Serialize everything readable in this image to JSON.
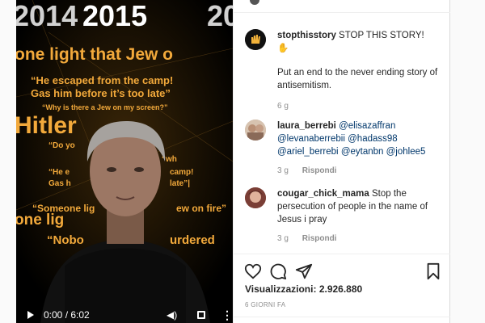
{
  "video": {
    "overlay_lines": [
      "2014",
      "2015",
      "20",
      "one light that Jew o",
      "“He escaped from the camp!",
      "Gas him before it’s too late”",
      "“Why is there a Jew on my screen?”",
      "Hitler",
      "“Do yo",
      "“wh",
      "“He e",
      "camp!",
      "Gas h",
      "late”|",
      "“Someone lig",
      "ew on fire”",
      "one lig",
      "“Nobo",
      "urdered"
    ],
    "time": "0:00 / 6:02",
    "progress": 0
  },
  "caption": {
    "username": "stopthisstory",
    "text_line1": "STOP THIS STORY!",
    "emoji": "✋",
    "text_line2": "Put an end to the never ending story of antisemitism.",
    "age": "6 g"
  },
  "comments": [
    {
      "username": "laura_berrebi",
      "mentions": [
        "@elisazaffran",
        "@levanaberrebii",
        "@hadass98",
        "@ariel_berrebi",
        "@eytanbn",
        "@johlee5"
      ],
      "age": "3 g",
      "reply": "Rispondi"
    },
    {
      "username": "cougar_chick_mama",
      "text": "Stop the persecution of people in the name of Jesus i pray",
      "age": "3 g",
      "reply": "Rispondi"
    }
  ],
  "stats": {
    "views_label": "Visualizzazioni:",
    "views_value": "2.926.880",
    "posted": "6 GIORNI FA"
  },
  "icons": [
    "heart-icon",
    "comment-icon",
    "share-icon",
    "bookmark-icon",
    "play-icon",
    "volume-icon",
    "fullscreen-icon",
    "more-icon"
  ],
  "colors": {
    "overlay_text": "#f2a93b",
    "mention": "#00376b",
    "muted": "#8e8e8e"
  }
}
